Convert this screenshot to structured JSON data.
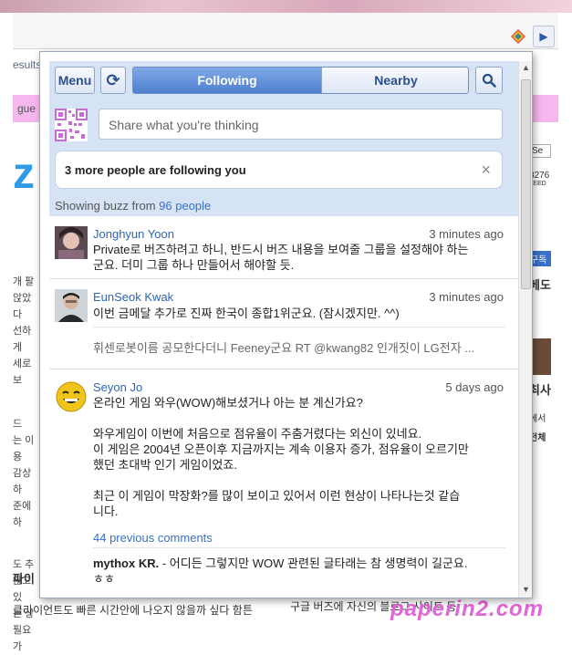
{
  "browser": {
    "results_label": "esults",
    "pinkbar_label": "gue",
    "bigz": "z",
    "left_snippets": [
      "개 팔",
      "앉았다",
      "선하게",
      "세로보",
      "드",
      "는 이용",
      "감상하",
      "준에 하",
      "도 추",
      "않고 있",
      "는 상",
      "필요가"
    ],
    "right_snippets": [
      "Se",
      "8276",
      "FEED",
      "구독",
      "베도",
      "최사",
      "에서",
      "전체"
    ],
    "bottom_text_1": "파이",
    "bottom_text_2": "클라이언트도 빠른 시간안에 나오지 않을까 싶다 함튼",
    "bottom_text_3": "구글 버즈에 자신의 블로그 사이트 등",
    "watermark": "paperin2.com"
  },
  "toolbar": {
    "menu_label": "Menu",
    "refresh_icon": "⟳",
    "tabs": [
      {
        "label": "Following",
        "active": true
      },
      {
        "label": "Nearby",
        "active": false
      }
    ]
  },
  "share": {
    "placeholder": "Share what you're thinking"
  },
  "notice": {
    "text": "3 more people are following you",
    "close": "×"
  },
  "showing": {
    "prefix": "Showing buzz from ",
    "link": "96 people"
  },
  "posts": [
    {
      "author": "Jonghyun Yoon",
      "time": "3 minutes ago",
      "body": "Private로 버즈하려고 하니, 반드시 버즈 내용을 보여줄 그룹을 설정해야 하는\n군요. 더미 그룹 하나 만들어서 해야할 듯."
    },
    {
      "author": "EunSeok Kwak",
      "time": "3 minutes ago",
      "body": "이번 금메달 추가로 진짜 한국이 종합1위군요. (잠시겠지만. ^^)",
      "sub": "휘센로봇이름 공모한다더니 Feeney군요 RT @kwang82 인개짓이 LG전자 ..."
    },
    {
      "author": "Seyon Jo",
      "time": "5 days ago",
      "body": "온라인 게임 와우(WOW)해보셨거나 아는 분 계신가요?\n\n와우게임이 이번에 처음으로 점유율이 주춤거렸다는 외신이 있네요.\n이 게임은 2004년 오픈이후 지금까지는 계속 이용자 증가, 점유율이 오르기만\n했던 초대박 인기 게임이었죠.\n\n최근 이 게임이 막장화?를 많이 보이고 있어서 이런 현상이 나타나는것 같습\n니다.",
      "previous_comments": "44 previous comments",
      "comment_author": "mythox KR.",
      "comment_text": " - 어디든 그렇지만 WOW 관련된 글타래는 참 생명력이 길군요.\nㅎㅎ"
    }
  ]
}
